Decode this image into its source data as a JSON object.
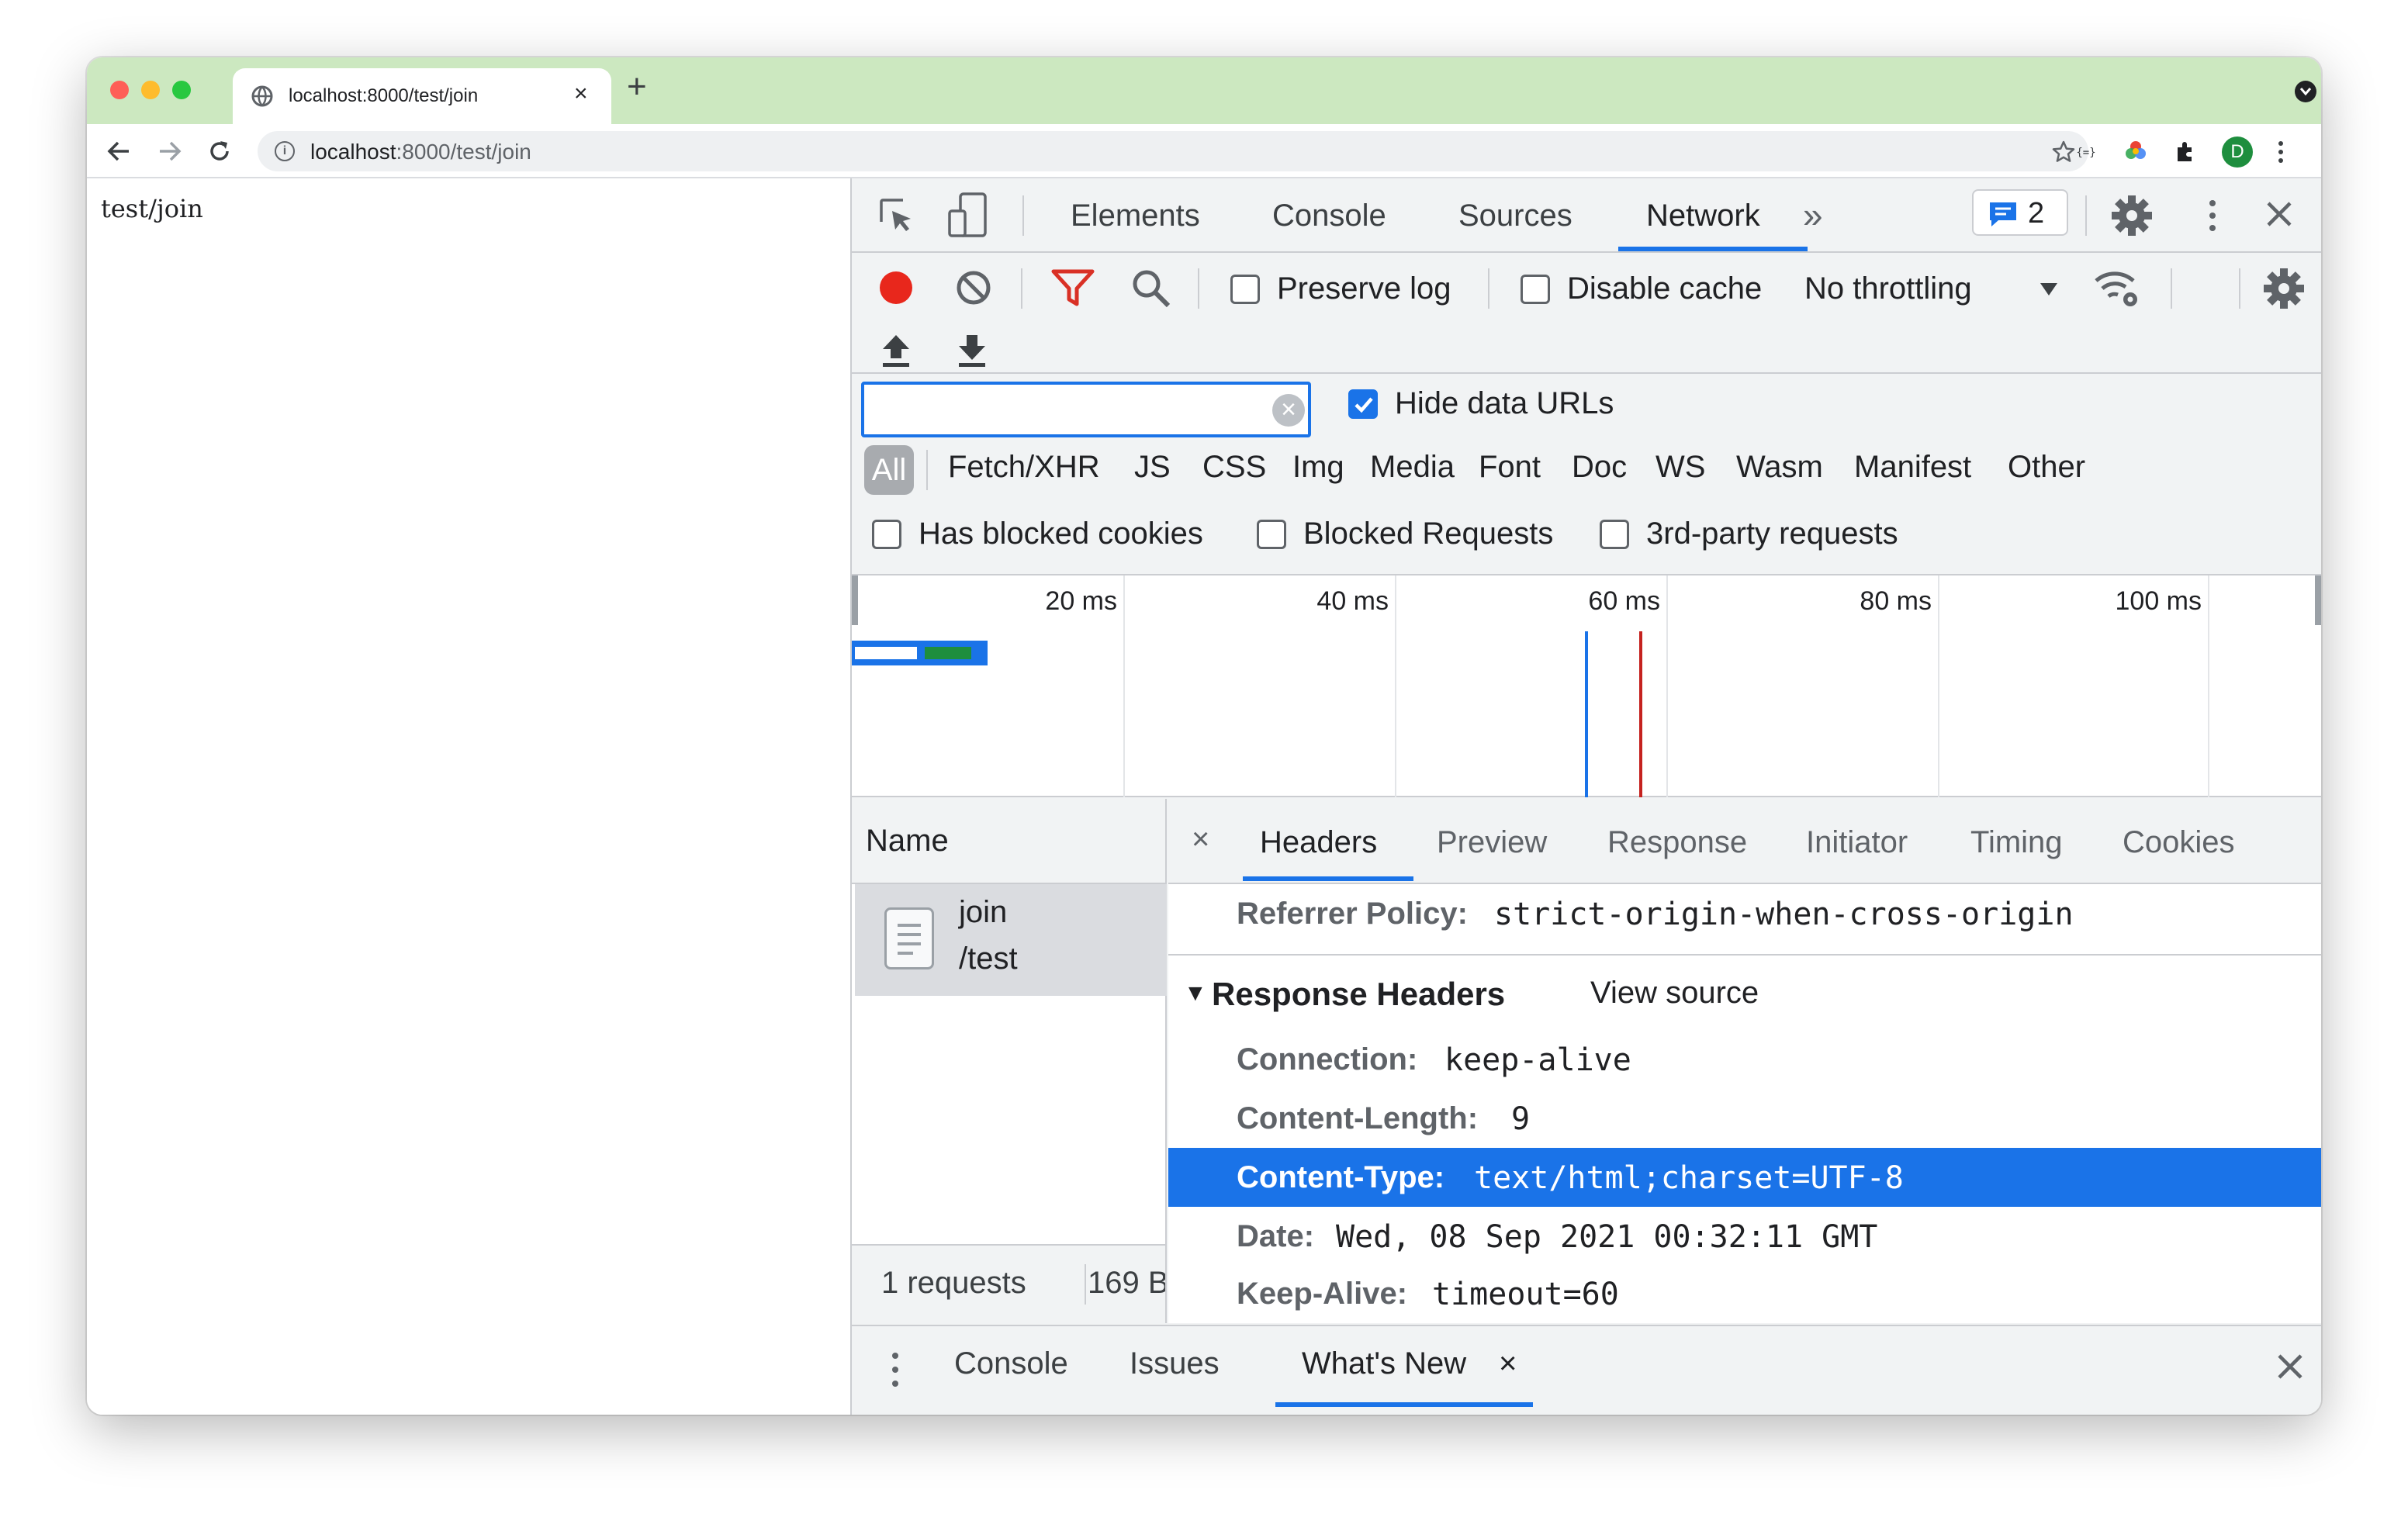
{
  "browser": {
    "tab_title": "localhost:8000/test/join",
    "tab_close": "×",
    "new_tab": "+",
    "url_host": "localhost",
    "url_rest": ":8000/test/join",
    "profile_initial": "D"
  },
  "page": {
    "body_text": "test/join"
  },
  "devtools": {
    "tabs": [
      "Elements",
      "Console",
      "Sources",
      "Network",
      "»"
    ],
    "active_tab": "Network",
    "issues_count": "2",
    "network_toolbar": {
      "preserve_log": "Preserve log",
      "disable_cache": "Disable cache",
      "throttling": "No throttling"
    },
    "filter": {
      "value": "",
      "hide_data_urls": "Hide data URLs",
      "hide_data_urls_checked": true,
      "types": [
        "All",
        "Fetch/XHR",
        "JS",
        "CSS",
        "Img",
        "Media",
        "Font",
        "Doc",
        "WS",
        "Wasm",
        "Manifest",
        "Other"
      ],
      "has_blocked_cookies": "Has blocked cookies",
      "blocked_requests": "Blocked Requests",
      "third_party": "3rd-party requests"
    },
    "overview": {
      "ticks": [
        "20 ms",
        "40 ms",
        "60 ms",
        "80 ms",
        "100 ms"
      ],
      "dom_content_loaded_ms": 54,
      "load_ms": 58,
      "request_start_ms": 0,
      "request_end_ms": 10
    },
    "requests": {
      "name_header": "Name",
      "rows": [
        {
          "name": "join",
          "path": "/test"
        }
      ],
      "summary_requests": "1 requests",
      "summary_transferred": "169 B"
    },
    "details": {
      "close": "×",
      "tabs": [
        "Headers",
        "Preview",
        "Response",
        "Initiator",
        "Timing",
        "Cookies"
      ],
      "active_tab": "Headers",
      "referrer_key": "Referrer Policy:",
      "referrer_val": "strict-origin-when-cross-origin",
      "section_title": "Response Headers",
      "view_source": "View source",
      "headers": [
        {
          "key": "Connection:",
          "value": "keep-alive"
        },
        {
          "key": "Content-Length:",
          "value": "9"
        },
        {
          "key": "Content-Type:",
          "value": "text/html;charset=UTF-8"
        },
        {
          "key": "Date:",
          "value": "Wed, 08 Sep 2021 00:32:11 GMT"
        },
        {
          "key": "Keep-Alive:",
          "value": "timeout=60"
        }
      ],
      "selected_header_index": 2
    },
    "drawer": {
      "tabs": [
        "Console",
        "Issues",
        "What's New"
      ],
      "active_tab": "What's New",
      "tab_close": "×"
    }
  },
  "colors": {
    "tabstrip": "#cce8c0",
    "accent": "#1a73e8",
    "record": "#e8271c",
    "filter_icon": "#d93025"
  }
}
